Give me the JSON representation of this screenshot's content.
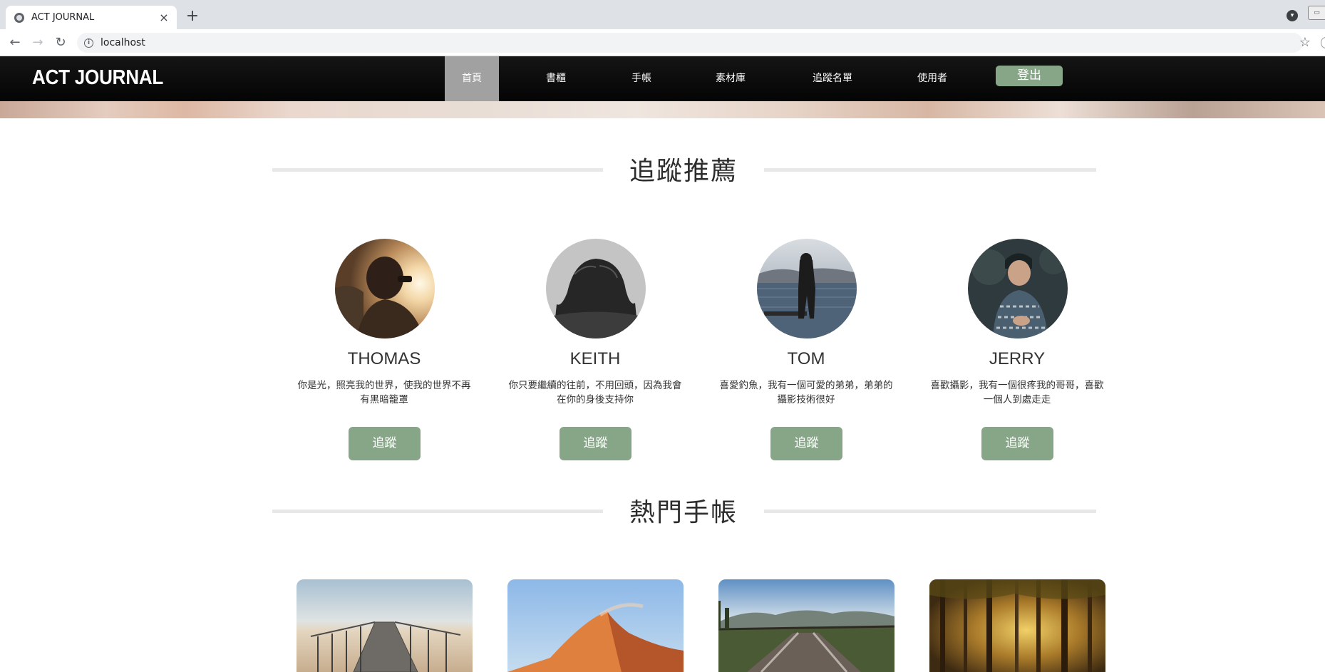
{
  "browser": {
    "tab_title": "ACT JOURNAL",
    "url": "localhost"
  },
  "site": {
    "brand": "ACT JOURNAL",
    "menu": [
      "首頁",
      "書櫃",
      "手帳",
      "素材庫",
      "追蹤名單",
      "使用者"
    ],
    "logout_label": "登出",
    "accent_color": "#87a687"
  },
  "recommend": {
    "title": "追蹤推薦",
    "users": [
      {
        "name": "THOMAS",
        "bio": "你是光，照亮我的世界，使我的世界不再有黑暗籠罩",
        "button": "追蹤"
      },
      {
        "name": "KEITH",
        "bio": "你只要繼續的往前，不用回頭，因為我會在你的身後支持你",
        "button": "追蹤"
      },
      {
        "name": "TOM",
        "bio": "喜愛釣魚，我有一個可愛的弟弟，弟弟的攝影技術很好",
        "button": "追蹤"
      },
      {
        "name": "JERRY",
        "bio": "喜歡攝影，我有一個很疼我的哥哥，喜歡一個人到處走走",
        "button": "追蹤"
      }
    ]
  },
  "popular": {
    "title": "熱門手帳"
  }
}
